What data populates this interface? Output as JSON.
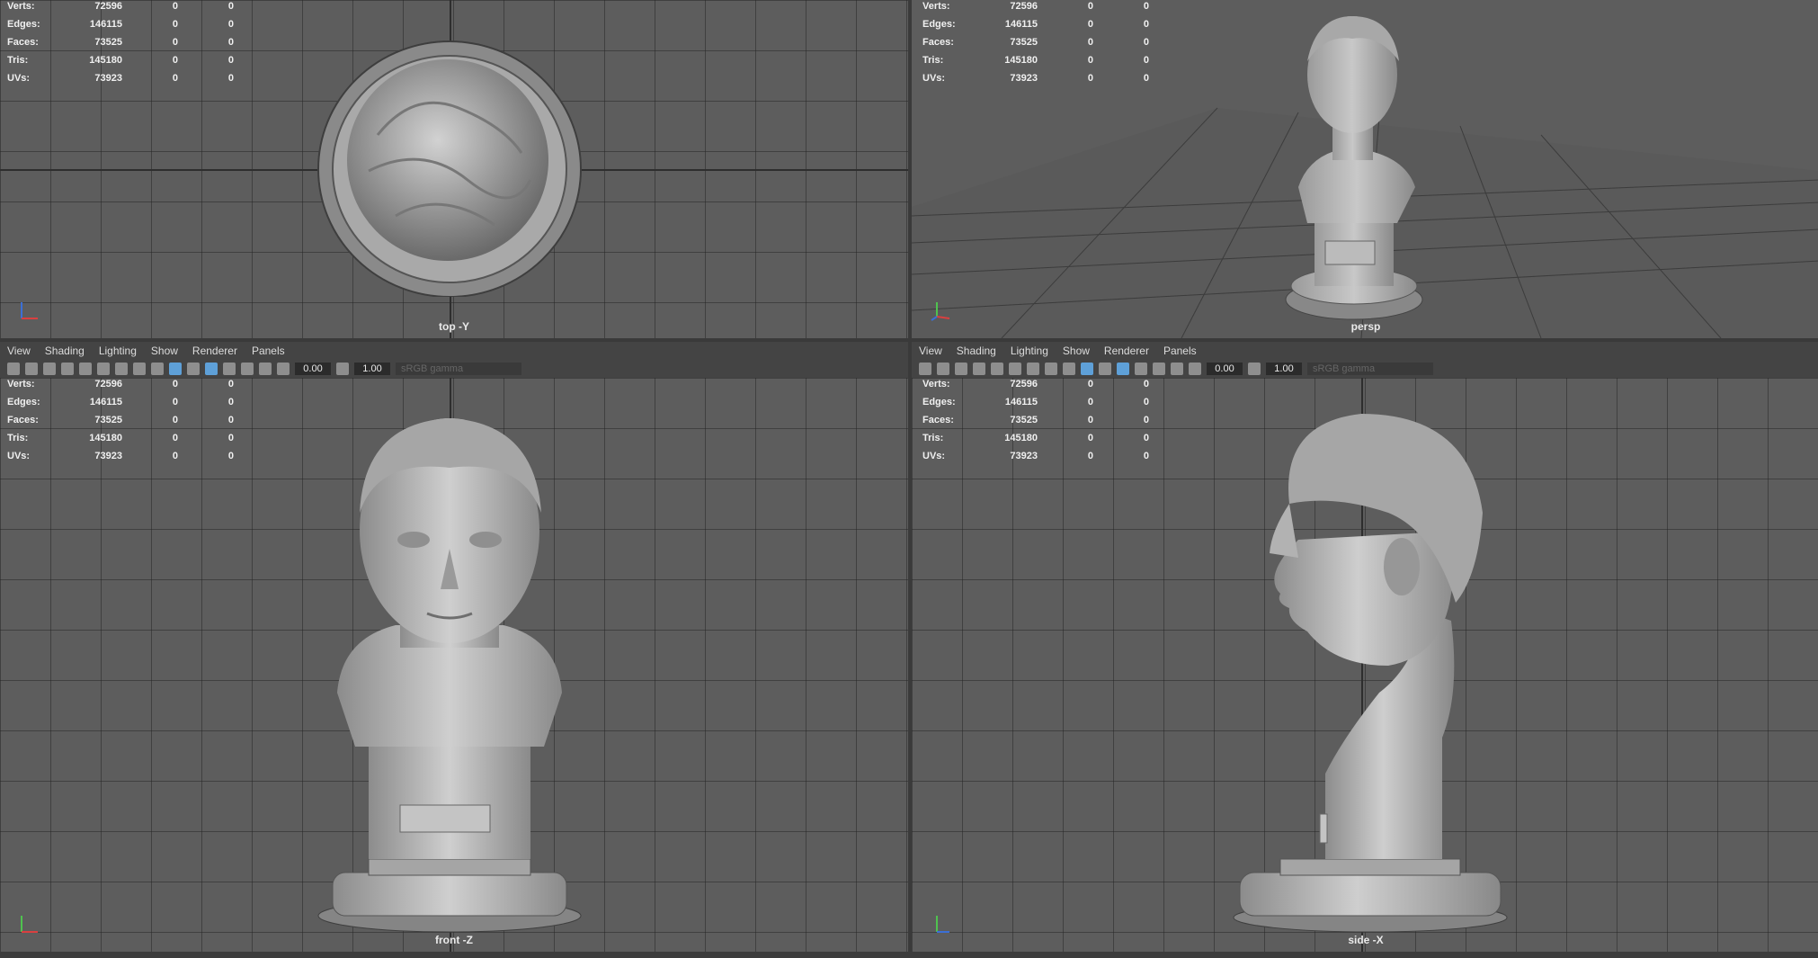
{
  "hud": {
    "rows": [
      {
        "label": "Verts:",
        "value": "72596",
        "c2": "0",
        "c3": "0"
      },
      {
        "label": "Edges:",
        "value": "146115",
        "c2": "0",
        "c3": "0"
      },
      {
        "label": "Faces:",
        "value": "73525",
        "c2": "0",
        "c3": "0"
      },
      {
        "label": "Tris:",
        "value": "145180",
        "c2": "0",
        "c3": "0"
      },
      {
        "label": "UVs:",
        "value": "73923",
        "c2": "0",
        "c3": "0"
      }
    ]
  },
  "panels": {
    "top": {
      "camera": "top -Y"
    },
    "persp": {
      "camera": "persp"
    },
    "front": {
      "camera": "front -Z"
    },
    "side": {
      "camera": "side -X"
    }
  },
  "menu": {
    "view": "View",
    "shading": "Shading",
    "lighting": "Lighting",
    "show": "Show",
    "renderer": "Renderer",
    "panels": "Panels"
  },
  "toolbar": {
    "exposure": "0.00",
    "gamma": "1.00",
    "color_space": "sRGB gamma"
  },
  "colors": {
    "viewport_bg": "#5d5d5d",
    "ui_bg": "#444444",
    "active_icon": "#5ea0d8"
  }
}
